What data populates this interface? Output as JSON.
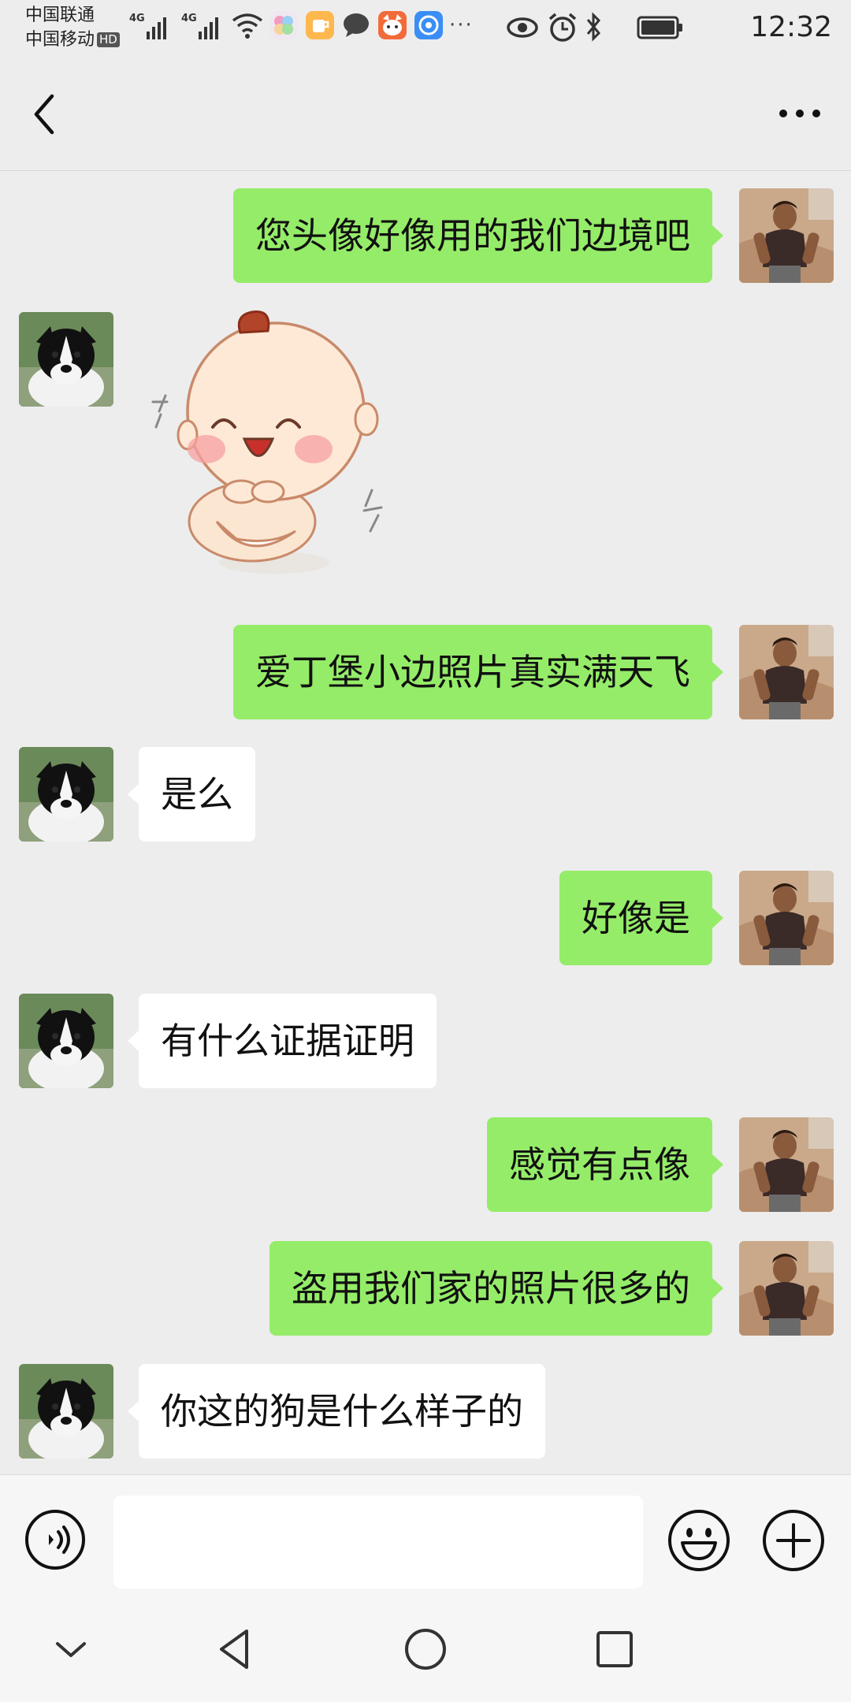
{
  "status_bar": {
    "carrier1": "中国联通",
    "carrier2": "中国移动",
    "hd_badge": "HD",
    "network1": "4G",
    "network2": "4G",
    "more_icons": "···",
    "time": "12:32"
  },
  "nav": {
    "back_icon": "chevron-left-icon",
    "more_icon": "ellipsis-icon"
  },
  "messages": [
    {
      "side": "right",
      "type": "text",
      "text": "您头像好像用的我们边境吧"
    },
    {
      "side": "left",
      "type": "sticker",
      "sticker": "laughing-baby-sticker"
    },
    {
      "side": "right",
      "type": "text",
      "text": "爱丁堡小边照片真实满天飞"
    },
    {
      "side": "left",
      "type": "text",
      "text": "是么"
    },
    {
      "side": "right",
      "type": "text",
      "text": "好像是"
    },
    {
      "side": "left",
      "type": "text",
      "text": "有什么证据证明"
    },
    {
      "side": "right",
      "type": "text",
      "text": "感觉有点像"
    },
    {
      "side": "right",
      "type": "text",
      "text": "盗用我们家的照片很多的"
    },
    {
      "side": "left",
      "type": "text",
      "text": "你这的狗是什么样子的"
    }
  ],
  "input_bar": {
    "voice_icon": "voice-icon",
    "input_value": "",
    "emoji_icon": "emoji-icon",
    "plus_icon": "plus-icon"
  },
  "system_nav": {
    "icons": [
      "chevron-down-icon",
      "back-triangle-icon",
      "home-circle-icon",
      "recents-square-icon"
    ]
  },
  "colors": {
    "background": "#ededed",
    "sent_bubble": "#95ec69",
    "received_bubble": "#ffffff"
  }
}
